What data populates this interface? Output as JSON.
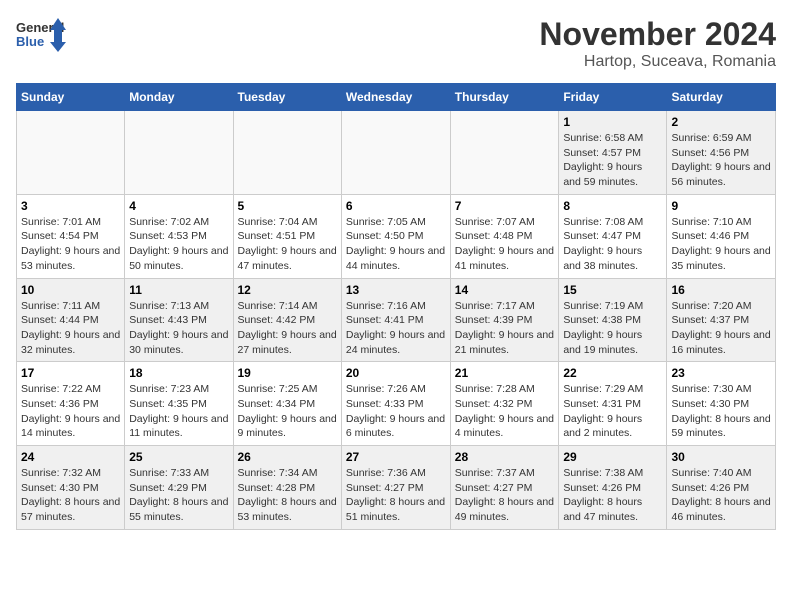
{
  "logo": {
    "line1": "General",
    "line2": "Blue"
  },
  "title": "November 2024",
  "location": "Hartop, Suceava, Romania",
  "weekdays": [
    "Sunday",
    "Monday",
    "Tuesday",
    "Wednesday",
    "Thursday",
    "Friday",
    "Saturday"
  ],
  "weeks": [
    [
      {
        "day": "",
        "info": ""
      },
      {
        "day": "",
        "info": ""
      },
      {
        "day": "",
        "info": ""
      },
      {
        "day": "",
        "info": ""
      },
      {
        "day": "",
        "info": ""
      },
      {
        "day": "1",
        "info": "Sunrise: 6:58 AM\nSunset: 4:57 PM\nDaylight: 9 hours and 59 minutes."
      },
      {
        "day": "2",
        "info": "Sunrise: 6:59 AM\nSunset: 4:56 PM\nDaylight: 9 hours and 56 minutes."
      }
    ],
    [
      {
        "day": "3",
        "info": "Sunrise: 7:01 AM\nSunset: 4:54 PM\nDaylight: 9 hours and 53 minutes."
      },
      {
        "day": "4",
        "info": "Sunrise: 7:02 AM\nSunset: 4:53 PM\nDaylight: 9 hours and 50 minutes."
      },
      {
        "day": "5",
        "info": "Sunrise: 7:04 AM\nSunset: 4:51 PM\nDaylight: 9 hours and 47 minutes."
      },
      {
        "day": "6",
        "info": "Sunrise: 7:05 AM\nSunset: 4:50 PM\nDaylight: 9 hours and 44 minutes."
      },
      {
        "day": "7",
        "info": "Sunrise: 7:07 AM\nSunset: 4:48 PM\nDaylight: 9 hours and 41 minutes."
      },
      {
        "day": "8",
        "info": "Sunrise: 7:08 AM\nSunset: 4:47 PM\nDaylight: 9 hours and 38 minutes."
      },
      {
        "day": "9",
        "info": "Sunrise: 7:10 AM\nSunset: 4:46 PM\nDaylight: 9 hours and 35 minutes."
      }
    ],
    [
      {
        "day": "10",
        "info": "Sunrise: 7:11 AM\nSunset: 4:44 PM\nDaylight: 9 hours and 32 minutes."
      },
      {
        "day": "11",
        "info": "Sunrise: 7:13 AM\nSunset: 4:43 PM\nDaylight: 9 hours and 30 minutes."
      },
      {
        "day": "12",
        "info": "Sunrise: 7:14 AM\nSunset: 4:42 PM\nDaylight: 9 hours and 27 minutes."
      },
      {
        "day": "13",
        "info": "Sunrise: 7:16 AM\nSunset: 4:41 PM\nDaylight: 9 hours and 24 minutes."
      },
      {
        "day": "14",
        "info": "Sunrise: 7:17 AM\nSunset: 4:39 PM\nDaylight: 9 hours and 21 minutes."
      },
      {
        "day": "15",
        "info": "Sunrise: 7:19 AM\nSunset: 4:38 PM\nDaylight: 9 hours and 19 minutes."
      },
      {
        "day": "16",
        "info": "Sunrise: 7:20 AM\nSunset: 4:37 PM\nDaylight: 9 hours and 16 minutes."
      }
    ],
    [
      {
        "day": "17",
        "info": "Sunrise: 7:22 AM\nSunset: 4:36 PM\nDaylight: 9 hours and 14 minutes."
      },
      {
        "day": "18",
        "info": "Sunrise: 7:23 AM\nSunset: 4:35 PM\nDaylight: 9 hours and 11 minutes."
      },
      {
        "day": "19",
        "info": "Sunrise: 7:25 AM\nSunset: 4:34 PM\nDaylight: 9 hours and 9 minutes."
      },
      {
        "day": "20",
        "info": "Sunrise: 7:26 AM\nSunset: 4:33 PM\nDaylight: 9 hours and 6 minutes."
      },
      {
        "day": "21",
        "info": "Sunrise: 7:28 AM\nSunset: 4:32 PM\nDaylight: 9 hours and 4 minutes."
      },
      {
        "day": "22",
        "info": "Sunrise: 7:29 AM\nSunset: 4:31 PM\nDaylight: 9 hours and 2 minutes."
      },
      {
        "day": "23",
        "info": "Sunrise: 7:30 AM\nSunset: 4:30 PM\nDaylight: 8 hours and 59 minutes."
      }
    ],
    [
      {
        "day": "24",
        "info": "Sunrise: 7:32 AM\nSunset: 4:30 PM\nDaylight: 8 hours and 57 minutes."
      },
      {
        "day": "25",
        "info": "Sunrise: 7:33 AM\nSunset: 4:29 PM\nDaylight: 8 hours and 55 minutes."
      },
      {
        "day": "26",
        "info": "Sunrise: 7:34 AM\nSunset: 4:28 PM\nDaylight: 8 hours and 53 minutes."
      },
      {
        "day": "27",
        "info": "Sunrise: 7:36 AM\nSunset: 4:27 PM\nDaylight: 8 hours and 51 minutes."
      },
      {
        "day": "28",
        "info": "Sunrise: 7:37 AM\nSunset: 4:27 PM\nDaylight: 8 hours and 49 minutes."
      },
      {
        "day": "29",
        "info": "Sunrise: 7:38 AM\nSunset: 4:26 PM\nDaylight: 8 hours and 47 minutes."
      },
      {
        "day": "30",
        "info": "Sunrise: 7:40 AM\nSunset: 4:26 PM\nDaylight: 8 hours and 46 minutes."
      }
    ]
  ]
}
